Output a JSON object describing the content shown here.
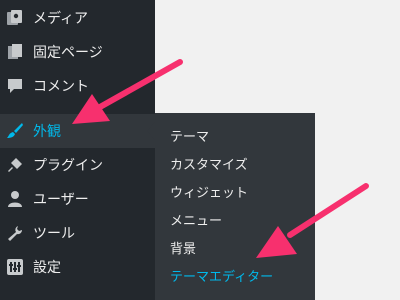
{
  "sidebar": {
    "items": [
      {
        "label": "メディア",
        "icon": "media-icon"
      },
      {
        "label": "固定ページ",
        "icon": "pages-icon"
      },
      {
        "label": "コメント",
        "icon": "comments-icon"
      },
      {
        "label": "外観",
        "icon": "appearance-brush-icon"
      },
      {
        "label": "プラグイン",
        "icon": "plugins-icon"
      },
      {
        "label": "ユーザー",
        "icon": "users-icon"
      },
      {
        "label": "ツール",
        "icon": "tools-wrench-icon"
      },
      {
        "label": "設定",
        "icon": "settings-icon"
      }
    ]
  },
  "submenu": {
    "items": [
      {
        "label": "テーマ"
      },
      {
        "label": "カスタマイズ"
      },
      {
        "label": "ウィジェット"
      },
      {
        "label": "メニュー"
      },
      {
        "label": "背景"
      },
      {
        "label": "テーマエディター"
      }
    ]
  },
  "colors": {
    "sidebar_bg": "#23282d",
    "submenu_bg": "#32373c",
    "active_text": "#00b9eb",
    "annotation_arrow": "#f7306e"
  }
}
